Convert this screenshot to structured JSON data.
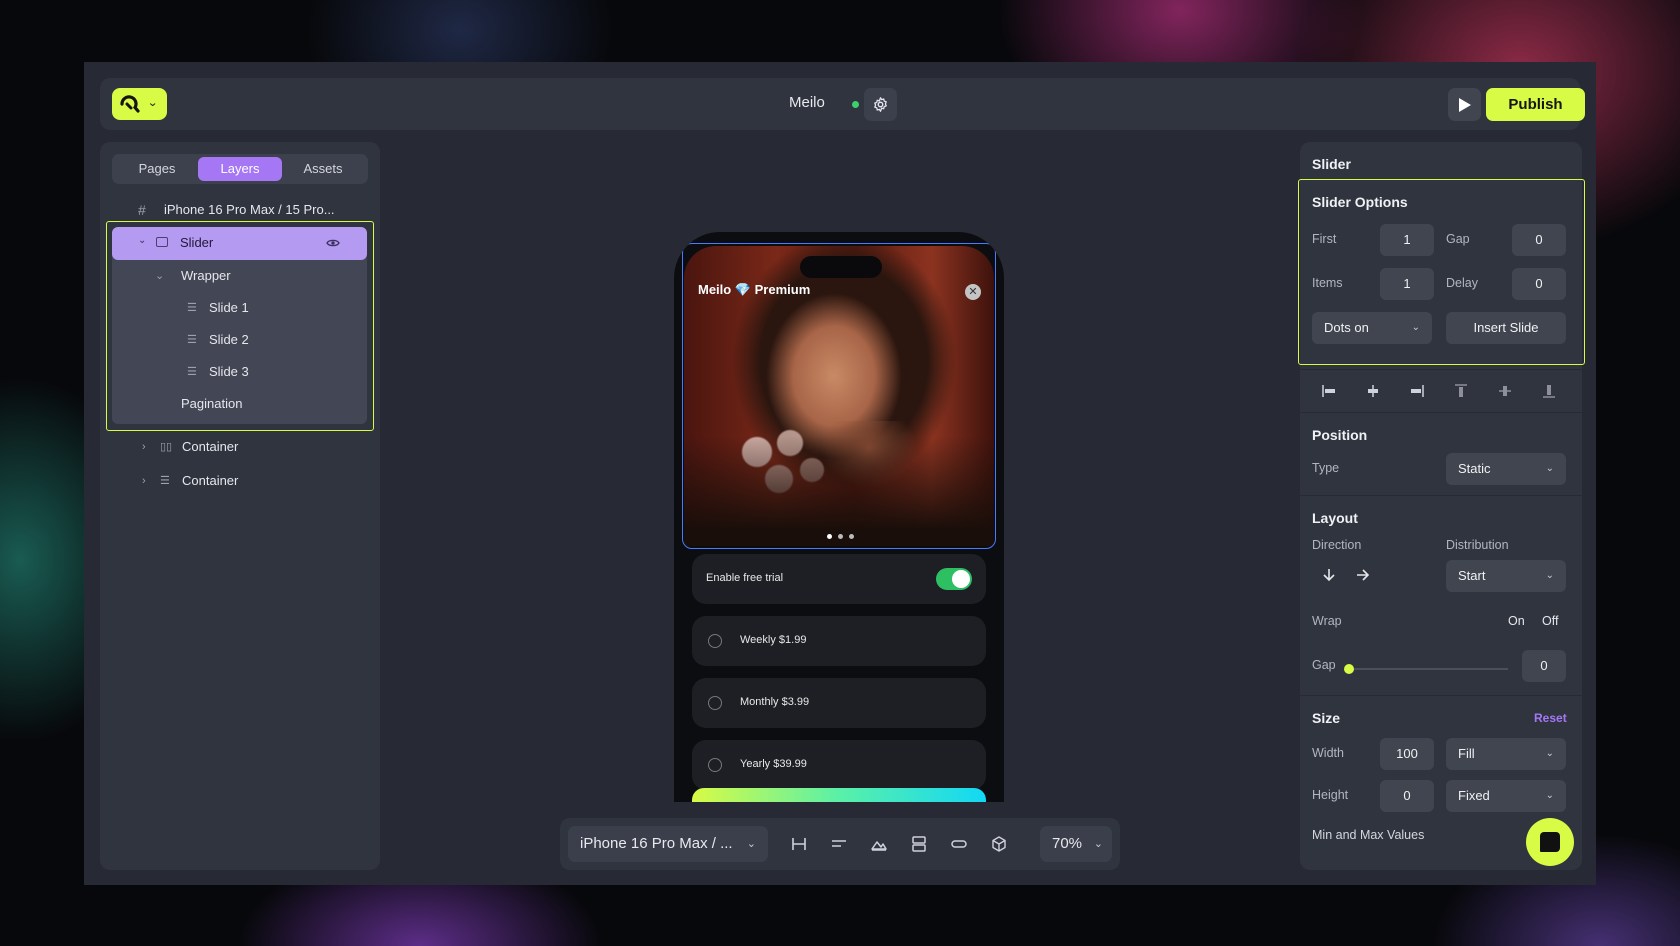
{
  "topbar": {
    "project_name": "Meilo",
    "publish_label": "Publish"
  },
  "left_panel": {
    "tabs": [
      {
        "label": "Pages"
      },
      {
        "label": "Layers"
      },
      {
        "label": "Assets"
      }
    ],
    "active_tab": "Layers",
    "layers": [
      {
        "label": "iPhone 16 Pro Max / 15 Pro..."
      },
      {
        "label": "Slider"
      },
      {
        "label": "Wrapper"
      },
      {
        "label": "Slide 1"
      },
      {
        "label": "Slide 2"
      },
      {
        "label": "Slide 3"
      },
      {
        "label": "Pagination"
      },
      {
        "label": "Container"
      },
      {
        "label": "Container"
      }
    ]
  },
  "phone": {
    "hero_title": "Meilo 💎 Premium",
    "trial_label": "Enable free trial",
    "trial_enabled": true,
    "plans": [
      {
        "label": "Weekly $1.99"
      },
      {
        "label": "Monthly $3.99"
      },
      {
        "label": "Yearly $39.99"
      }
    ]
  },
  "bottombar": {
    "device": "iPhone 16 Pro Max / ...",
    "zoom": "70%"
  },
  "right_panel": {
    "title": "Slider",
    "slider_options": {
      "heading": "Slider Options",
      "first_label": "First",
      "first_value": "1",
      "gap_label": "Gap",
      "gap_value": "0",
      "items_label": "Items",
      "items_value": "1",
      "delay_label": "Delay",
      "delay_value": "0",
      "dots_value": "Dots on",
      "insert_label": "Insert Slide"
    },
    "position": {
      "heading": "Position",
      "type_label": "Type",
      "type_value": "Static"
    },
    "layout": {
      "heading": "Layout",
      "direction_label": "Direction",
      "distribution_label": "Distribution",
      "distribution_value": "Start",
      "wrap_label": "Wrap",
      "wrap_on": "On",
      "wrap_off": "Off",
      "gap_label": "Gap",
      "gap_value": "0"
    },
    "size": {
      "heading": "Size",
      "reset_label": "Reset",
      "width_label": "Width",
      "width_value": "100",
      "width_mode": "Fill",
      "height_label": "Height",
      "height_value": "0",
      "height_mode": "Fixed",
      "minmax_label": "Min and Max Values"
    }
  },
  "colors": {
    "accent": "#d8fb45",
    "selection": "#a577f5",
    "panel": "#30343f",
    "toggle_on": "#2fbf63"
  }
}
